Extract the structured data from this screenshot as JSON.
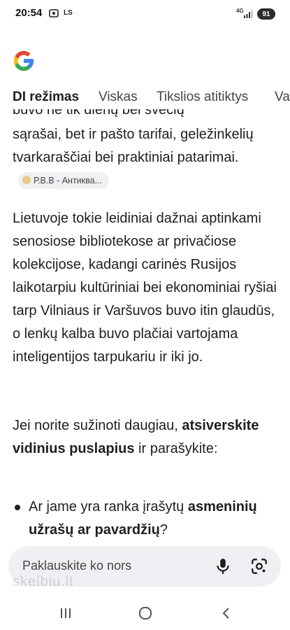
{
  "status": {
    "time": "20:54",
    "ls": "LS",
    "network": "4G",
    "battery": "91"
  },
  "logo": "google-g",
  "tabs": [
    "DI režimas",
    "Viskas",
    "Tikslios atitiktys",
    "Va"
  ],
  "content": {
    "cut_line": "buvo ne tik dienų bei svečių",
    "para1": "sąrašai, bet ir pašto tarifai, geležinkelių tvarkaraščiai bei praktiniai patarimai.",
    "chip": "Р.В.В - Антиква...",
    "para2": "Lietuvoje tokie leidiniai dažnai aptinkami senosiose bibliotekose ar privačiose kolekcijose, kadangi carinės Rusijos laikotarpiu kultūriniai bei ekonominiai ryšiai tarp Vilniaus ir Varšuvos buvo itin glaudūs, o lenkų kalba buvo plačiai vartojama inteligentijos tarpukariu ir iki jo.",
    "para3_start": "Jei norite sužinoti daugiau, ",
    "para3_bold": "atsiverskite vidinius puslapius",
    "para3_end": " ir parašykite:",
    "bullet_start": "Ar jame yra ranka įrašytų ",
    "bullet_bold": "asmeninių užrašų ar pavardžių",
    "bullet_end": "?"
  },
  "search": {
    "placeholder": "Paklauskite ko nors"
  },
  "watermark": "skelbiu.lt",
  "colors": {
    "google_blue": "#4285F4",
    "google_red": "#EA4335",
    "google_yellow": "#FBBC05",
    "google_green": "#34A853",
    "search_bg": "#eef0f3"
  }
}
